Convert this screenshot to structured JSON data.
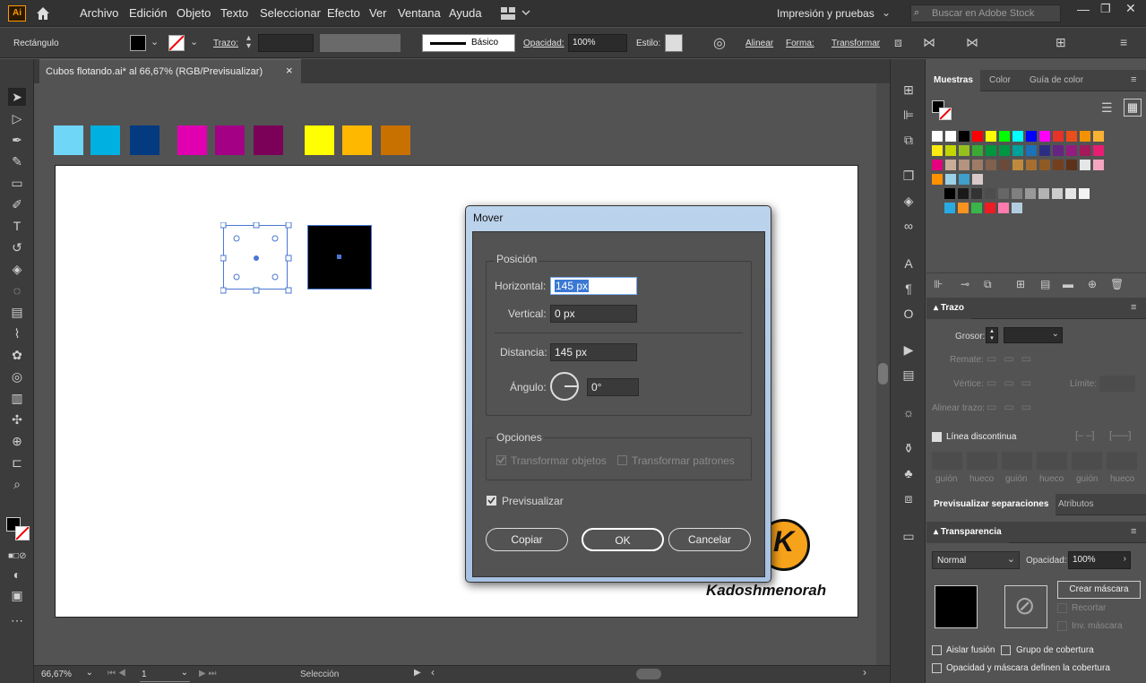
{
  "app": {
    "logo": "Ai",
    "workspace": "Impresión y pruebas",
    "search_placeholder": "Buscar en Adobe Stock"
  },
  "menu": [
    "Archivo",
    "Edición",
    "Objeto",
    "Texto",
    "Seleccionar",
    "Efecto",
    "Ver",
    "Ventana",
    "Ayuda"
  ],
  "control": {
    "object_type": "Rectángulo",
    "trazo_label": "Trazo:",
    "stroke_style": "Básico",
    "opacidad_label": "Opacidad:",
    "opacidad": "100%",
    "estilo_label": "Estilo:",
    "alinear": "Alinear",
    "forma": "Forma:",
    "transformar": "Transformar"
  },
  "document": {
    "tab_title": "Cubos flotando.ai* al 66,67% (RGB/Previsualizar)",
    "close": "×"
  },
  "swatches_canvas": [
    "#6fd6f7",
    "#00b0e0",
    "#043a80",
    "#e000b0",
    "#a30086",
    "#7a0058",
    "#ffff00",
    "#ffb800",
    "#c87000"
  ],
  "dialog": {
    "title": "Mover",
    "posicion": "Posición",
    "horizontal_label": "Horizontal:",
    "horizontal": "145 px",
    "vertical_label": "Vertical:",
    "vertical": "0 px",
    "distancia_label": "Distancia:",
    "distancia": "145 px",
    "angulo_label": "Ángulo:",
    "angulo": "0°",
    "opciones": "Opciones",
    "transformar_objetos": "Transformar objetos",
    "transformar_patrones": "Transformar patrones",
    "previsualizar": "Previsualizar",
    "copiar": "Copiar",
    "ok": "OK",
    "cancelar": "Cancelar"
  },
  "watermark": {
    "letter": "K",
    "name": "Kadoshmenorah"
  },
  "panels": {
    "muestras_tabs": [
      "Muestras",
      "Color",
      "Guía de color"
    ],
    "trazo": {
      "title": "Trazo",
      "grosor": "Grosor:",
      "remate": "Remate:",
      "vertice": "Vértice:",
      "limite": "Límite:",
      "alinear_trazo": "Alinear trazo:",
      "linea_discontinua": "Línea discontinua",
      "dash_labels": [
        "guión",
        "hueco",
        "guión",
        "hueco",
        "guión",
        "hueco"
      ]
    },
    "sep_tabs": [
      "Previsualizar separaciones",
      "Atributos"
    ],
    "transparencia": {
      "title": "Transparencia",
      "mode": "Normal",
      "opacidad_label": "Opacidad:",
      "opacidad": "100%",
      "crear_mascara": "Crear máscara",
      "recortar": "Recortar",
      "inv_mascara": "Inv. máscara",
      "aislar": "Aislar fusión",
      "grupo": "Grupo de cobertura",
      "opacidad_mascara": "Opacidad y máscara definen la cobertura"
    }
  },
  "status": {
    "zoom": "66,67%",
    "page": "1",
    "tool": "Selección"
  },
  "swatch_grid": [
    [
      "#ffffff",
      "#ffffff",
      "#000000",
      "#ff0000",
      "#ffff00",
      "#00ff00",
      "#00ffff",
      "#0000ff",
      "#ff00ff",
      "#e6332a",
      "#e94e1b",
      "#f39200",
      "#f9b233"
    ],
    [
      "#fcea10",
      "#c4d600",
      "#95c11f",
      "#3aaa35",
      "#009640",
      "#009641",
      "#00a19a",
      "#1d71b8",
      "#2d2e83",
      "#662483",
      "#951b81",
      "#a3195b",
      "#e71d73"
    ],
    [
      "#e5007e",
      "#c9ad98",
      "#b4937f",
      "#9d7b67",
      "#82604e",
      "#6b4a3a",
      "#c08a3c",
      "#a66f2f",
      "#8e5b25",
      "#753f1d",
      "#5d3218",
      "#e6e6e6",
      "#f4a6c0"
    ],
    [
      "#ff9000",
      "#9ad1e8",
      "#3f9fca",
      "#d8c8c8"
    ],
    [
      "#000000",
      "#1a1a1a",
      "#333333",
      "#4d4d4d",
      "#666666",
      "#808080",
      "#999999",
      "#b3b3b3",
      "#cccccc",
      "#e6e6e6",
      "#f2f2f2"
    ],
    [
      "#29abe2",
      "#f7931e",
      "#39b54a",
      "#ed1c24",
      "#ff7bac",
      "#b3cde0"
    ]
  ]
}
